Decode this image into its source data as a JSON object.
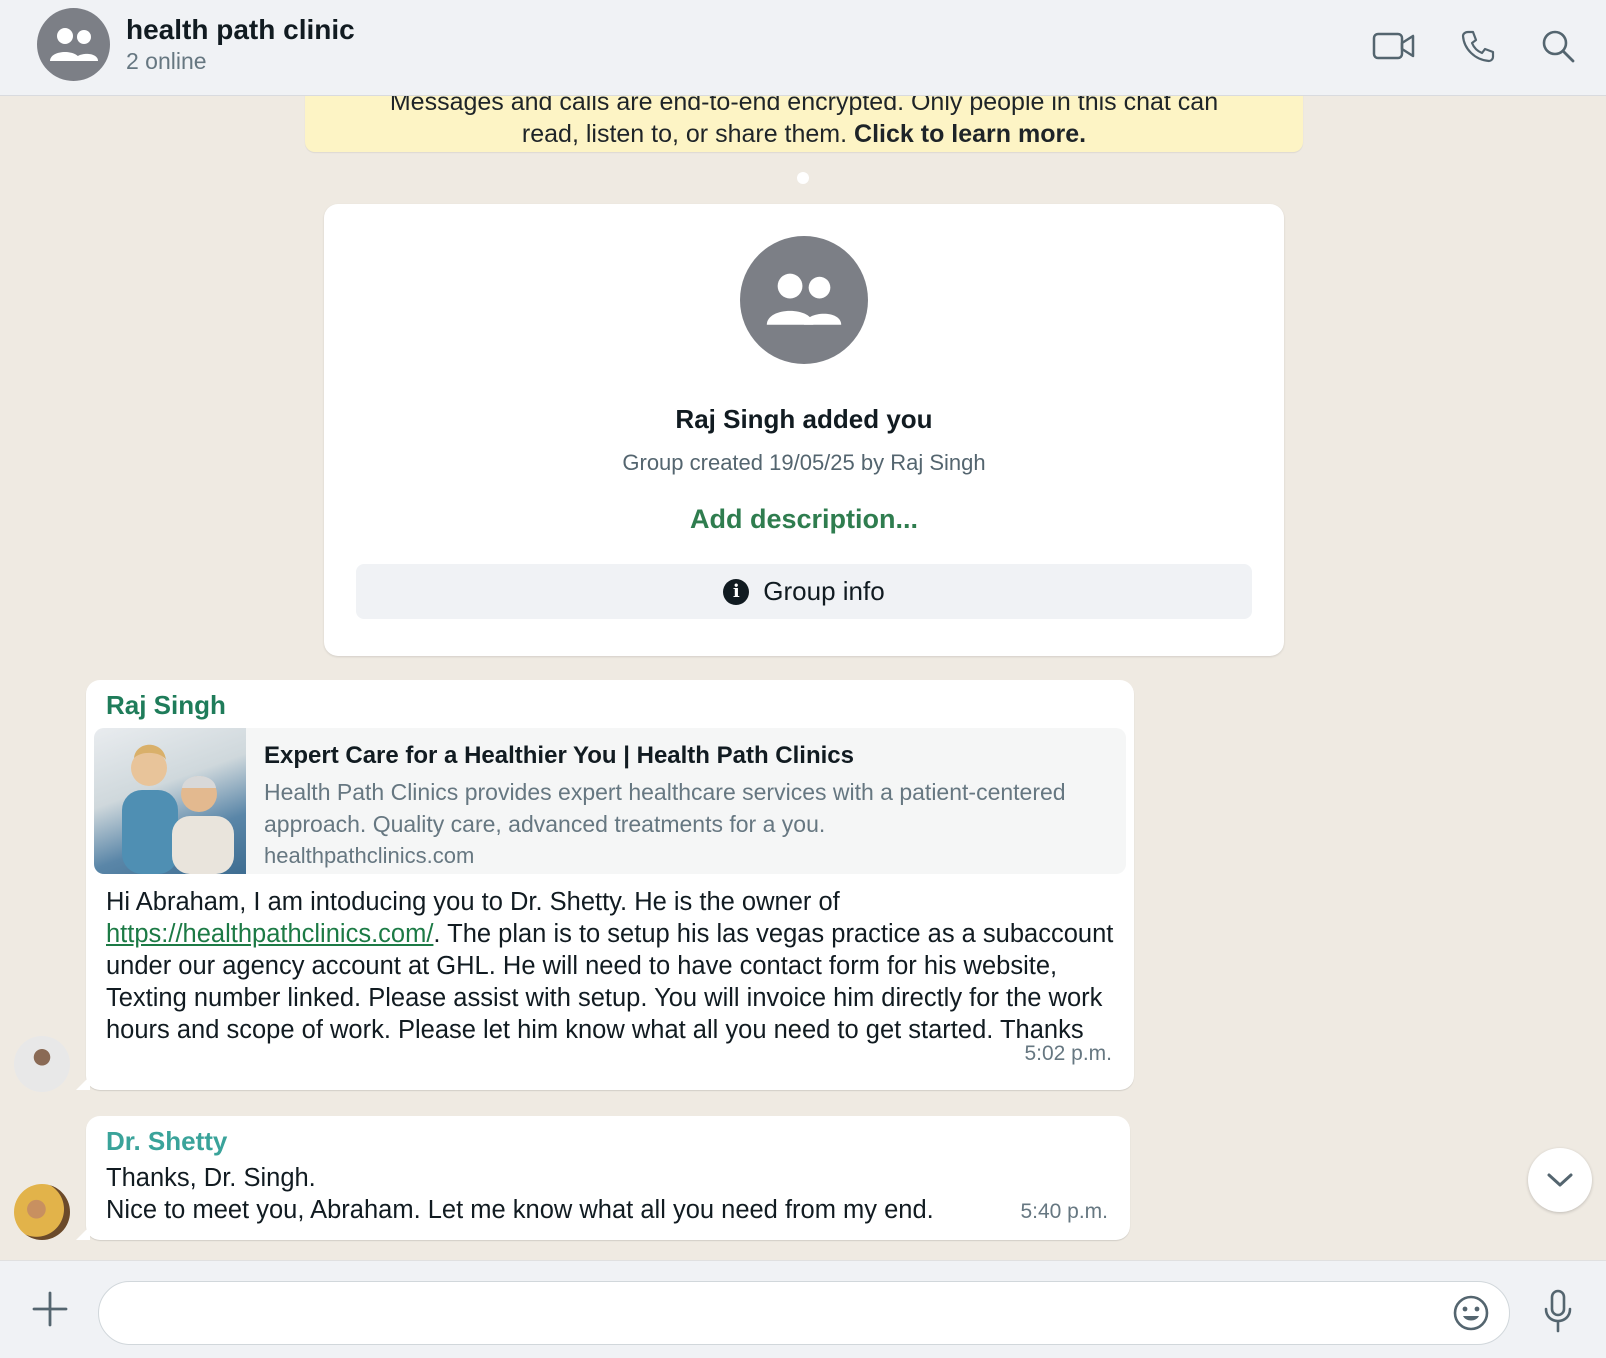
{
  "header": {
    "title": "health path clinic",
    "subtitle": "2 online",
    "icons": [
      "group-avatar-icon",
      "video-call-icon",
      "phone-icon",
      "search-icon"
    ]
  },
  "encryption_banner": {
    "line1": "Messages and calls are end-to-end encrypted. Only people in this chat can",
    "line2": "read, listen to, or share them.",
    "link": "Click to learn more."
  },
  "group_card": {
    "added_text": "Raj  Singh added you",
    "created_text": "Group created 19/05/25 by Raj  Singh",
    "add_description": "Add description...",
    "group_info": "Group info"
  },
  "messages": [
    {
      "sender": "Raj  Singh",
      "preview": {
        "title": "Expert Care for a Healthier You | Health Path Clinics",
        "desc_line1": "Health Path Clinics provides expert healthcare services with a patient-centered",
        "desc_line2": "approach. Quality care, advanced treatments for a you.",
        "domain": "healthpathclinics.com"
      },
      "text_before_link": "Hi Abraham, I am intoducing you to Dr. Shetty. He is the owner of ",
      "link": "https://healthpathclinics.com/",
      "text_after_link": ". The plan is to setup his las vegas practice as a subaccount under our agency account at GHL. He will need to have contact form for his website, Texting number linked. Please assist with setup. You will invoice him directly for the work hours and scope of work. Please let him know what all you need to get started. Thanks",
      "time": "5:02 p.m."
    },
    {
      "sender": "Dr. Shetty",
      "line1": "Thanks, Dr. Singh.",
      "line2": "Nice to meet you, Abraham. Let me know what all you need from my end.",
      "time": "5:40 p.m."
    }
  ],
  "composer": {
    "placeholder": ""
  }
}
